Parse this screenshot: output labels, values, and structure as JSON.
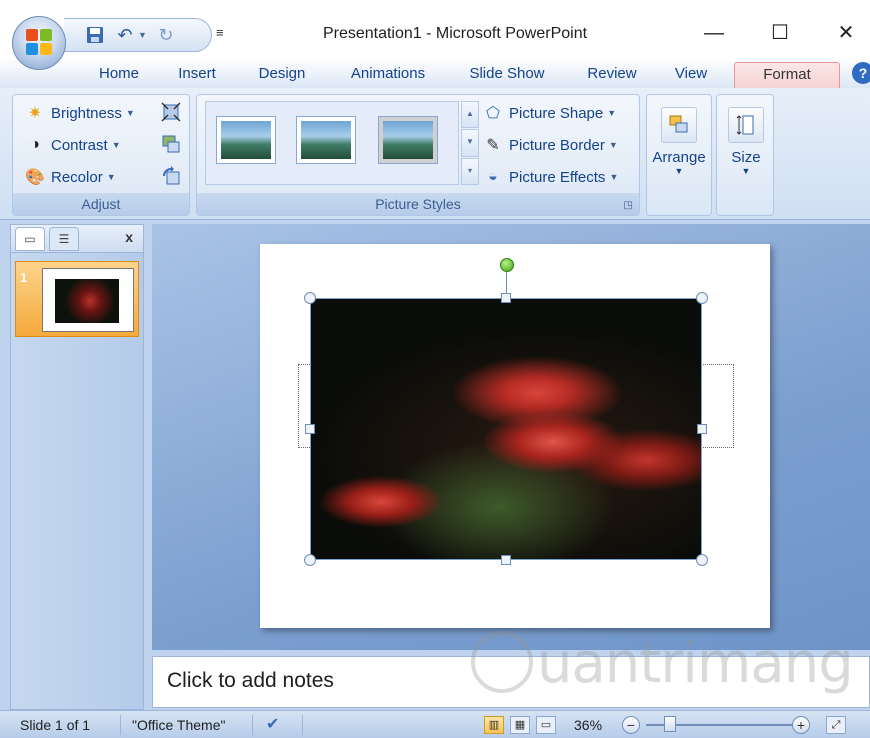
{
  "window": {
    "title": "Presentation1 - Microsoft PowerPoint",
    "minimize": "—",
    "maximize": "☐",
    "close": "✕"
  },
  "qat": {
    "save_icon": "save-icon",
    "undo_icon": "undo-icon",
    "redo_icon": "redo-icon",
    "more": "≡"
  },
  "tabs": [
    {
      "label": "Home"
    },
    {
      "label": "Insert"
    },
    {
      "label": "Design"
    },
    {
      "label": "Animations"
    },
    {
      "label": "Slide Show"
    },
    {
      "label": "Review"
    },
    {
      "label": "View"
    },
    {
      "label": "Format"
    }
  ],
  "help": "?",
  "ribbon": {
    "adjust": {
      "label": "Adjust",
      "brightness": "Brightness",
      "contrast": "Contrast",
      "recolor": "Recolor"
    },
    "picture_styles": {
      "label": "Picture Styles",
      "shape": "Picture Shape",
      "border": "Picture Border",
      "effects": "Picture Effects"
    },
    "arrange": {
      "label": "Arrange"
    },
    "size": {
      "label": "Size"
    }
  },
  "left_panel": {
    "close": "x",
    "slide_number": "1"
  },
  "notes": {
    "placeholder": "Click to add notes"
  },
  "watermark": "uantrimang",
  "status": {
    "slide": "Slide 1 of 1",
    "theme": "\"Office Theme\"",
    "zoom": "36%",
    "zoom_out": "−",
    "zoom_in": "+"
  }
}
